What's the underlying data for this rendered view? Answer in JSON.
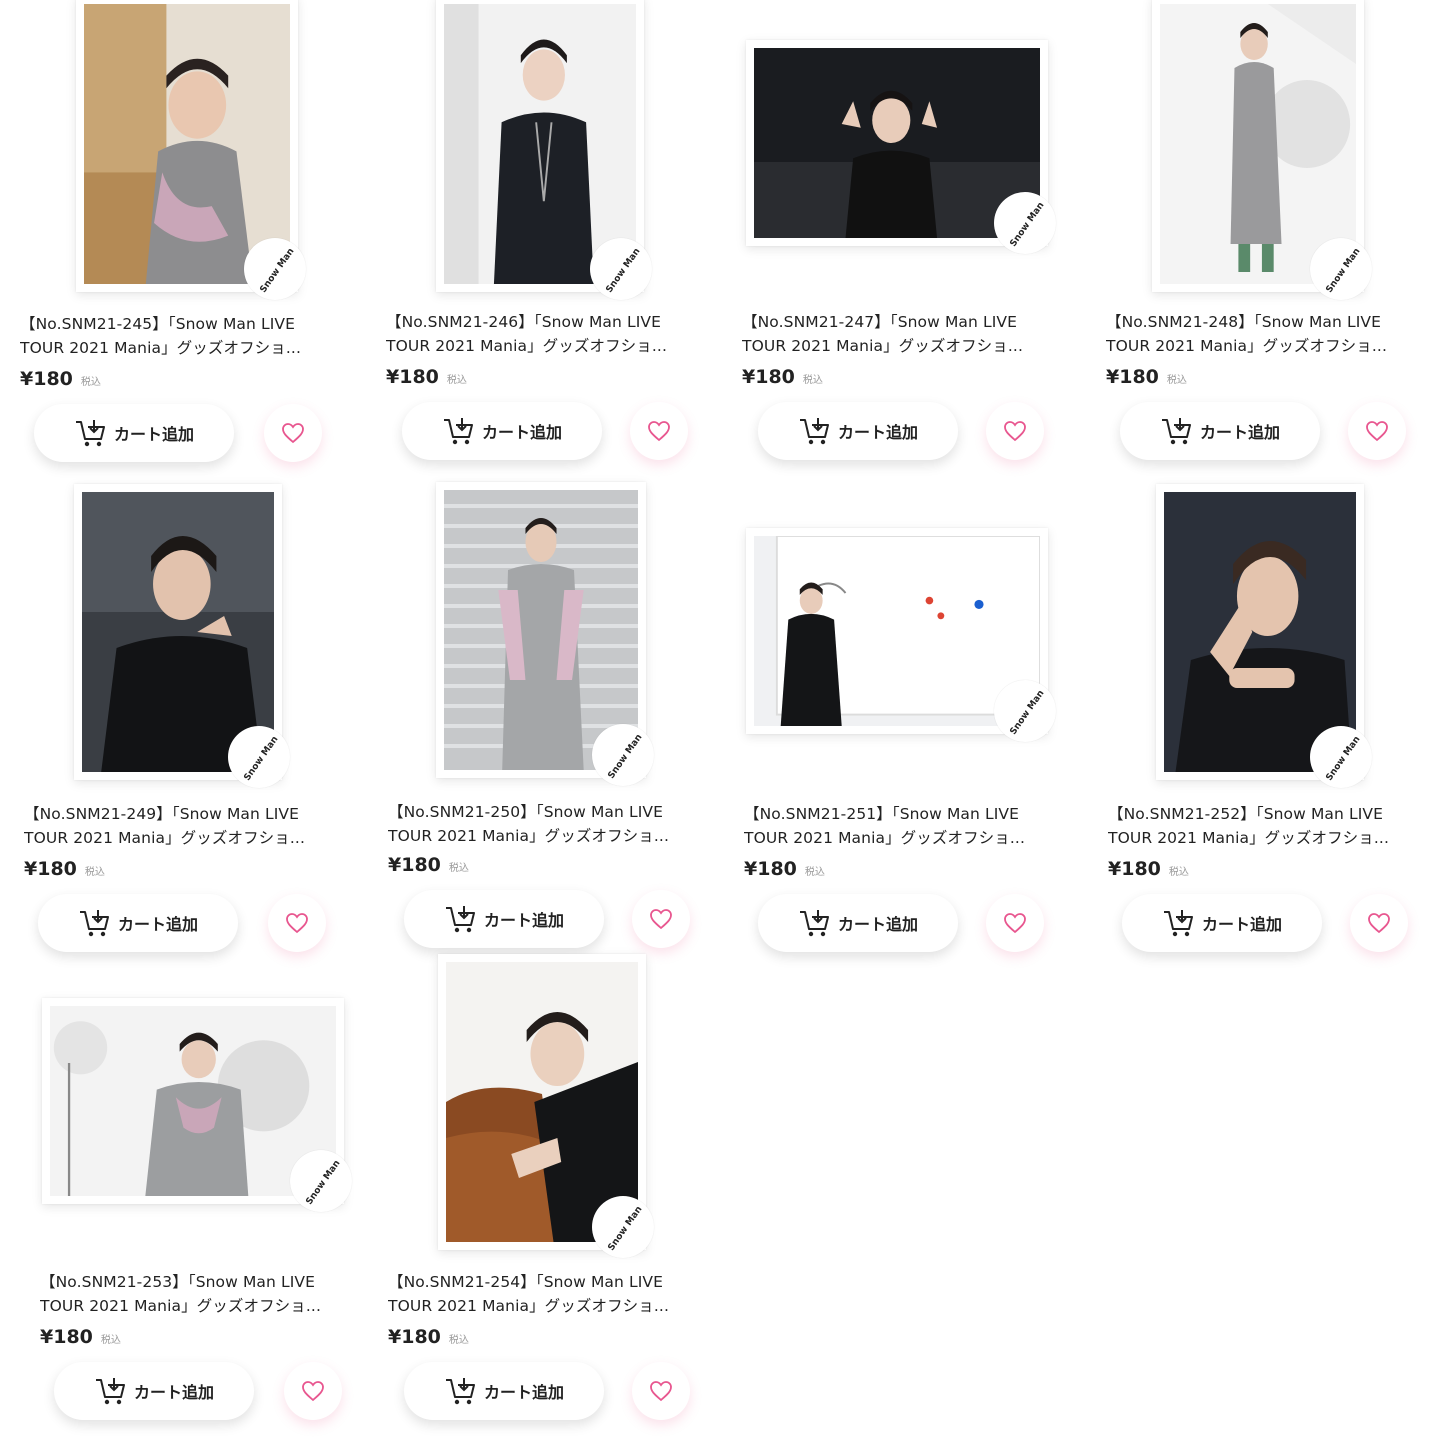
{
  "products": [
    {
      "title_line1": "【No.SNM21-245】「Snow Man LIVE",
      "title_line2": "TOUR 2021 Mania」グッズオフショ...",
      "price": "¥180",
      "tax_label": "税込",
      "cart_label": "カート追加"
    },
    {
      "title_line1": "【No.SNM21-246】「Snow Man LIVE",
      "title_line2": "TOUR 2021 Mania」グッズオフショ...",
      "price": "¥180",
      "tax_label": "税込",
      "cart_label": "カート追加"
    },
    {
      "title_line1": "【No.SNM21-247】「Snow Man LIVE",
      "title_line2": "TOUR 2021 Mania」グッズオフショ...",
      "price": "¥180",
      "tax_label": "税込",
      "cart_label": "カート追加"
    },
    {
      "title_line1": "【No.SNM21-248】「Snow Man LIVE",
      "title_line2": "TOUR 2021 Mania」グッズオフショ...",
      "price": "¥180",
      "tax_label": "税込",
      "cart_label": "カート追加"
    },
    {
      "title_line1": "【No.SNM21-249】「Snow Man LIVE",
      "title_line2": "TOUR 2021 Mania」グッズオフショ...",
      "price": "¥180",
      "tax_label": "税込",
      "cart_label": "カート追加"
    },
    {
      "title_line1": "【No.SNM21-250】「Snow Man LIVE",
      "title_line2": "TOUR 2021 Mania」グッズオフショ...",
      "price": "¥180",
      "tax_label": "税込",
      "cart_label": "カート追加"
    },
    {
      "title_line1": "【No.SNM21-251】「Snow Man LIVE",
      "title_line2": "TOUR 2021 Mania」グッズオフショ...",
      "price": "¥180",
      "tax_label": "税込",
      "cart_label": "カート追加"
    },
    {
      "title_line1": "【No.SNM21-252】「Snow Man LIVE",
      "title_line2": "TOUR 2021 Mania」グッズオフショ...",
      "price": "¥180",
      "tax_label": "税込",
      "cart_label": "カート追加"
    },
    {
      "title_line1": "【No.SNM21-253】「Snow Man LIVE",
      "title_line2": "TOUR 2021 Mania」グッズオフショ...",
      "price": "¥180",
      "tax_label": "税込",
      "cart_label": "カート追加"
    },
    {
      "title_line1": "【No.SNM21-254】「Snow Man LIVE",
      "title_line2": "TOUR 2021 Mania」グッズオフショ...",
      "price": "¥180",
      "tax_label": "税込",
      "cart_label": "カート追加"
    }
  ],
  "logo_text": "Snow Man",
  "icons": {
    "cart": "cart-add-icon",
    "favorite": "heart-outline-icon"
  },
  "colors": {
    "accent_pink": "#e8568f",
    "text": "#222222",
    "muted": "#999999"
  }
}
